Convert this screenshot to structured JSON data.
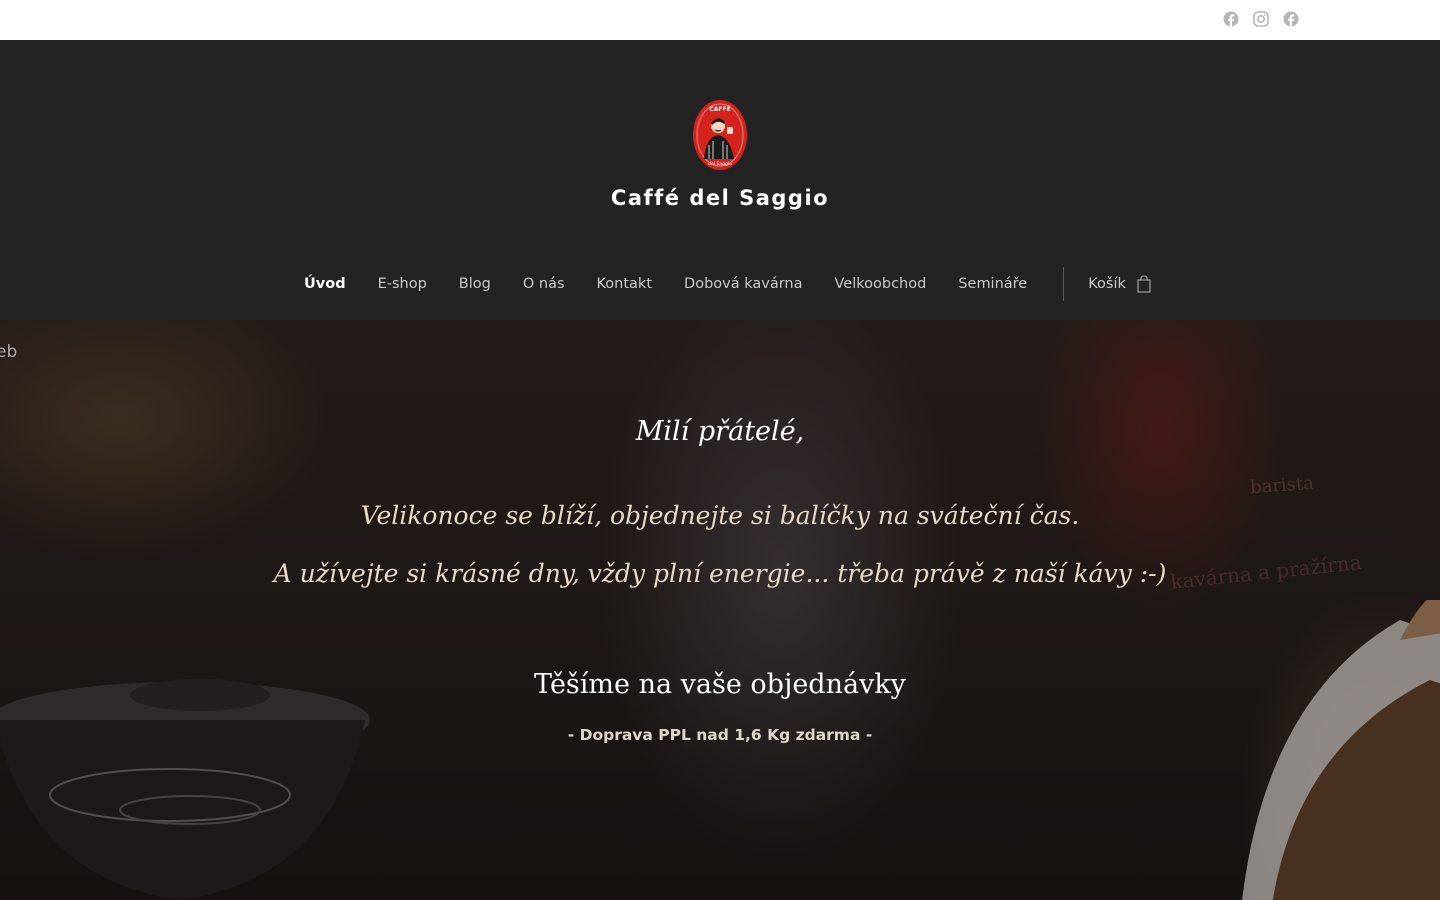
{
  "social": {
    "icons": [
      "facebook-icon",
      "instagram-icon",
      "facebook-icon"
    ]
  },
  "header": {
    "brand": "Caffé del Saggio",
    "logo_text_top": "CAFFÉ",
    "logo_text_bottom": "del Saggio"
  },
  "nav": {
    "items": [
      {
        "label": "Úvod",
        "active": true
      },
      {
        "label": "E-shop",
        "active": false
      },
      {
        "label": "Blog",
        "active": false
      },
      {
        "label": "O nás",
        "active": false
      },
      {
        "label": "Kontakt",
        "active": false
      },
      {
        "label": "Dobová kavárna",
        "active": false
      },
      {
        "label": "Velkoobchod",
        "active": false
      },
      {
        "label": "Semináře",
        "active": false
      }
    ],
    "cart_label": "Košík",
    "cart_icon": "shopping-bag-icon"
  },
  "hero": {
    "edge_text": "eb",
    "greeting": "Milí přátelé,",
    "message_line1": "Velikonoce se blíží, objednejte si balíčky na sváteční čas.",
    "message_line2": "A užívejte si krásné dny, vždy plní energie... třeba právě z naší kávy :-)",
    "cta": "Těšíme na vaše objednávky",
    "shipping": "- Doprava PPL nad 1,6 Kg zdarma -",
    "background_sign_text1": "barista",
    "background_sign_text2": "kavárna a pražírna"
  },
  "colors": {
    "header_bg": "#232323",
    "topbar_bg": "#ffffff",
    "logo_red": "#d3231c",
    "nav_text": "#c9c9c9",
    "active_nav": "#ffffff"
  }
}
